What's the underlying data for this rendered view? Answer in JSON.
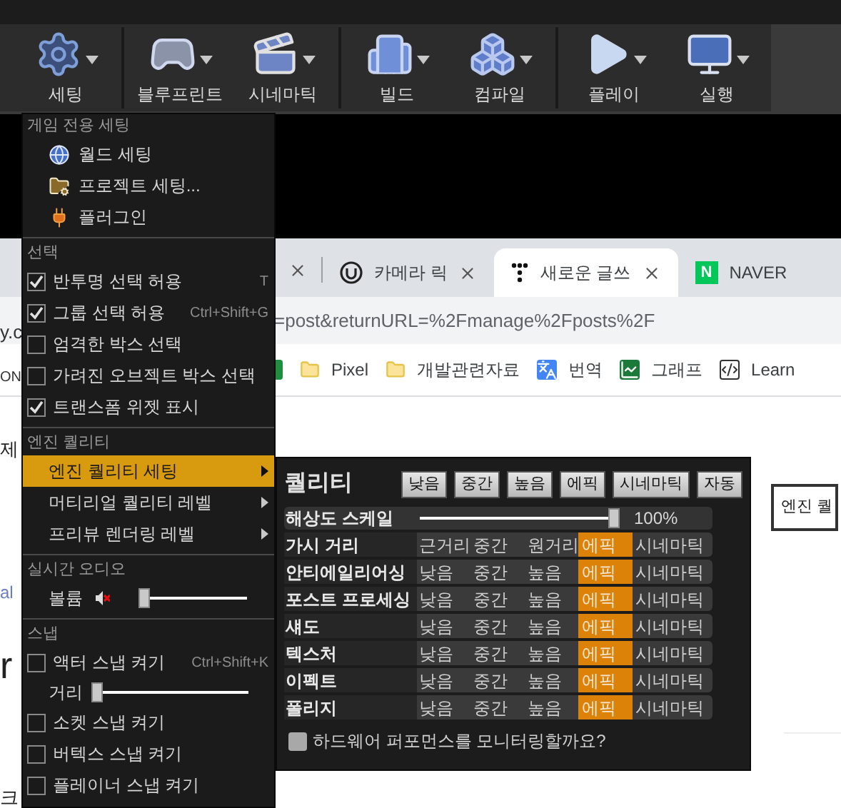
{
  "toolbar": {
    "buttons": [
      {
        "label": "세팅"
      },
      {
        "label": "블루프린트"
      },
      {
        "label": "시네마틱"
      },
      {
        "label": "빌드"
      },
      {
        "label": "컴파일"
      },
      {
        "label": "플레이"
      },
      {
        "label": "실행"
      }
    ]
  },
  "browser": {
    "tabs": [
      {
        "label": "카메라 릭",
        "selected": false
      },
      {
        "label": "새로운 글쓰",
        "selected": true
      },
      {
        "label": "NAVER",
        "selected": false,
        "logo": "N"
      }
    ],
    "address": "=post&returnURL=%2Fmanage%2Fposts%2F",
    "bookmarks": [
      "Pixel",
      "개발관련자료",
      "번역",
      "그래프",
      "Learn"
    ],
    "left_fragments": [
      "y.c",
      "ON",
      "제",
      "al",
      "r",
      "크"
    ],
    "page_button": "엔진 퀄"
  },
  "menu": {
    "sections": [
      {
        "heading": "게임 전용 세팅",
        "items": [
          {
            "kind": "link",
            "label": "월드 세팅"
          },
          {
            "kind": "link",
            "label": "프로젝트 세팅..."
          },
          {
            "kind": "link",
            "label": "플러그인"
          }
        ]
      },
      {
        "heading": "선택",
        "items": [
          {
            "kind": "check",
            "label": "반투명 선택 허용",
            "checked": true,
            "shortcut": "T"
          },
          {
            "kind": "check",
            "label": "그룹 선택 허용",
            "checked": true,
            "shortcut": "Ctrl+Shift+G"
          },
          {
            "kind": "check",
            "label": "엄격한 박스 선택",
            "checked": false
          },
          {
            "kind": "check",
            "label": "가려진 오브젝트 박스 선택",
            "checked": false
          },
          {
            "kind": "check",
            "label": "트랜스폼 위젯 표시",
            "checked": true
          }
        ]
      },
      {
        "heading": "엔진 퀄리티",
        "items": [
          {
            "kind": "submenu",
            "label": "엔진 퀄리티 세팅",
            "selected": true
          },
          {
            "kind": "submenu",
            "label": "머티리얼 퀄리티 레벨",
            "selected": false
          },
          {
            "kind": "submenu",
            "label": "프리뷰 렌더링 레벨",
            "selected": false
          }
        ]
      },
      {
        "heading": "실시간 오디오",
        "items": [
          {
            "kind": "volume",
            "label": "볼륨",
            "level": 0
          }
        ]
      },
      {
        "heading": "스냅",
        "items": [
          {
            "kind": "check",
            "label": "액터 스냅 켜기",
            "checked": false,
            "shortcut": "Ctrl+Shift+K"
          },
          {
            "kind": "slider",
            "label": "거리",
            "level": 0
          },
          {
            "kind": "check",
            "label": "소켓 스냅 켜기",
            "checked": false
          },
          {
            "kind": "check",
            "label": "버텍스 스냅 켜기",
            "checked": false
          },
          {
            "kind": "check",
            "label": "플레이너 스냅 켜기",
            "checked": false
          }
        ]
      }
    ]
  },
  "quality": {
    "title": "퀄리티",
    "presets": [
      "낮음",
      "중간",
      "높음",
      "에픽",
      "시네마틱",
      "자동"
    ],
    "scale": {
      "label": "해상도 스케일",
      "level": 1,
      "reading": "100%"
    },
    "rows": [
      {
        "label": "가시 거리",
        "options": [
          {
            "label": "근거리",
            "selected": false
          },
          {
            "label": "중간",
            "selected": false
          },
          {
            "label": "원거리",
            "selected": false
          },
          {
            "label": "에픽",
            "selected": true
          },
          {
            "label": "시네마틱",
            "selected": false
          }
        ]
      },
      {
        "label": "안티에일리어싱",
        "options": [
          {
            "label": "낮음",
            "selected": false
          },
          {
            "label": "중간",
            "selected": false
          },
          {
            "label": "높음",
            "selected": false
          },
          {
            "label": "에픽",
            "selected": true
          },
          {
            "label": "시네마틱",
            "selected": false
          }
        ]
      },
      {
        "label": "포스트 프로세싱",
        "options": [
          {
            "label": "낮음",
            "selected": false
          },
          {
            "label": "중간",
            "selected": false
          },
          {
            "label": "높음",
            "selected": false
          },
          {
            "label": "에픽",
            "selected": true
          },
          {
            "label": "시네마틱",
            "selected": false
          }
        ]
      },
      {
        "label": "섀도",
        "options": [
          {
            "label": "낮음",
            "selected": false
          },
          {
            "label": "중간",
            "selected": false
          },
          {
            "label": "높음",
            "selected": false
          },
          {
            "label": "에픽",
            "selected": true
          },
          {
            "label": "시네마틱",
            "selected": false
          }
        ]
      },
      {
        "label": "텍스처",
        "options": [
          {
            "label": "낮음",
            "selected": false
          },
          {
            "label": "중간",
            "selected": false
          },
          {
            "label": "높음",
            "selected": false
          },
          {
            "label": "에픽",
            "selected": true
          },
          {
            "label": "시네마틱",
            "selected": false
          }
        ]
      },
      {
        "label": "이펙트",
        "options": [
          {
            "label": "낮음",
            "selected": false
          },
          {
            "label": "중간",
            "selected": false
          },
          {
            "label": "높음",
            "selected": false
          },
          {
            "label": "에픽",
            "selected": true
          },
          {
            "label": "시네마틱",
            "selected": false
          }
        ]
      },
      {
        "label": "폴리지",
        "options": [
          {
            "label": "낮음",
            "selected": false
          },
          {
            "label": "중간",
            "selected": false
          },
          {
            "label": "높음",
            "selected": false
          },
          {
            "label": "에픽",
            "selected": true
          },
          {
            "label": "시네마틱",
            "selected": false
          }
        ]
      }
    ],
    "monitor": {
      "label": "하드웨어 퍼포먼스를 모니터링할까요?",
      "checked": false
    }
  }
}
